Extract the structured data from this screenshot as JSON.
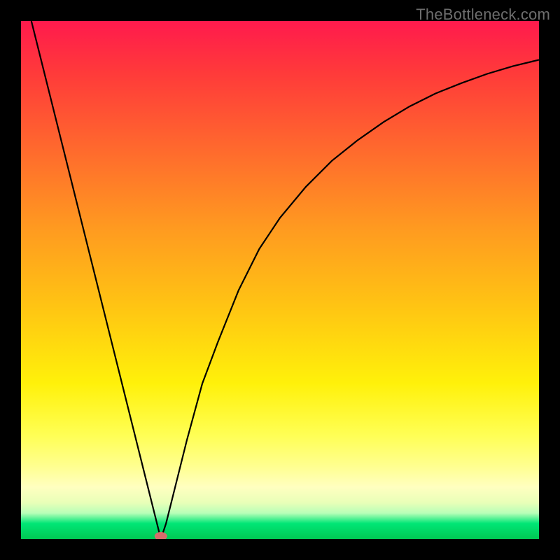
{
  "watermark": "TheBottleneck.com",
  "chart_data": {
    "type": "line",
    "title": "",
    "xlabel": "",
    "ylabel": "",
    "xlim": [
      0,
      100
    ],
    "ylim": [
      0,
      100
    ],
    "series": [
      {
        "name": "bottleneck-curve",
        "x": [
          2,
          4,
          6,
          8,
          10,
          12,
          14,
          16,
          18,
          20,
          22,
          24,
          26,
          27,
          28,
          30,
          32,
          35,
          38,
          42,
          46,
          50,
          55,
          60,
          65,
          70,
          75,
          80,
          85,
          90,
          95,
          100
        ],
        "values": [
          100,
          92,
          84,
          76,
          68,
          60,
          52,
          44,
          36,
          28,
          20,
          12,
          4,
          0,
          3,
          11,
          19,
          30,
          38,
          48,
          56,
          62,
          68,
          73,
          77,
          80.5,
          83.5,
          86,
          88,
          89.8,
          91.3,
          92.5
        ]
      }
    ],
    "marker": {
      "x": 27,
      "y": 0
    },
    "background_gradient": {
      "0": "#ff1a4d",
      "25": "#ff6a2d",
      "55": "#ffc413",
      "80": "#ffff55",
      "100": "#00c853"
    }
  }
}
